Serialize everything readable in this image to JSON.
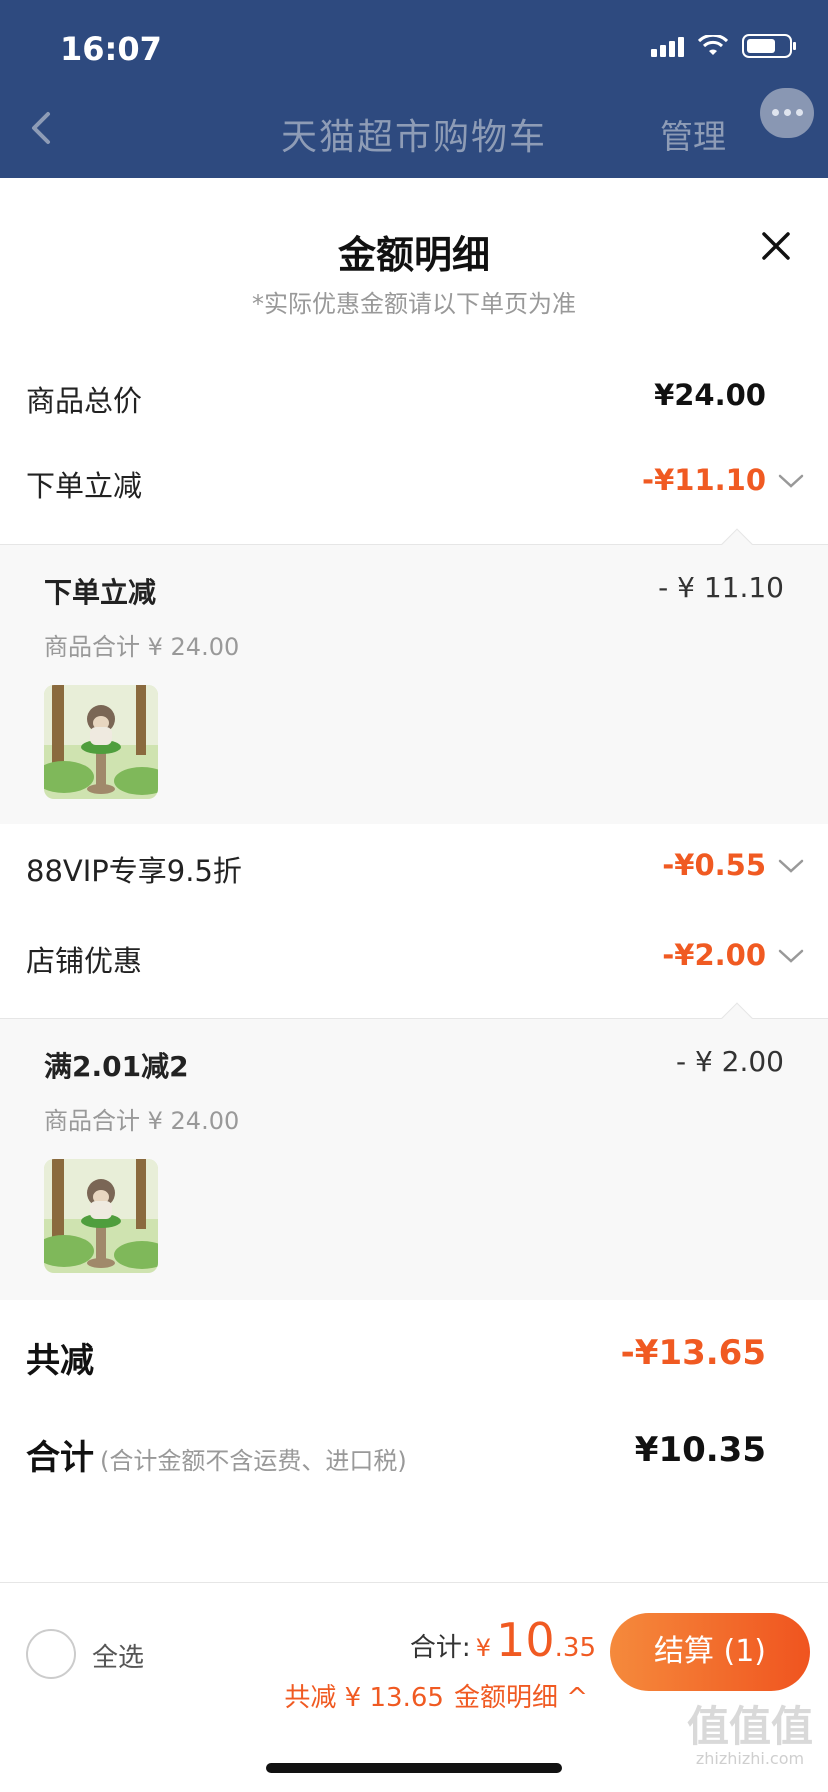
{
  "status_bar": {
    "time": "16:07"
  },
  "nav": {
    "title": "天猫超市购物车",
    "manage": "管理"
  },
  "sheet": {
    "title": "金额明细",
    "subtitle": "*实际优惠金额请以下单页为准",
    "rows": {
      "goods_total": {
        "label": "商品总价",
        "value": "¥24.00"
      },
      "instant_discount": {
        "label": "下单立减",
        "value": "-¥11.10"
      },
      "vip_discount": {
        "label": "88VIP专享9.5折",
        "value": "-¥0.55"
      },
      "shop_discount": {
        "label": "店铺优惠",
        "value": "-¥2.00"
      }
    },
    "details": {
      "instant": {
        "title": "下单立减",
        "amount": "- ¥ 11.10",
        "sub": "商品合计 ¥ 24.00"
      },
      "shop": {
        "title": "满2.01减2",
        "amount": "- ¥ 2.00",
        "sub": "商品合计 ¥ 24.00"
      }
    },
    "total_reduction": {
      "label": "共减",
      "value": "-¥13.65"
    },
    "grand_total": {
      "label": "合计",
      "note": "(合计金额不含运费、进口税)",
      "value": "¥10.35"
    }
  },
  "bottom_bar": {
    "select_all": "全选",
    "total_label": "合计:",
    "currency": "¥",
    "total_int": "10",
    "total_dec": ".35",
    "reduction_text": "共减 ¥ 13.65",
    "detail_link": "金额明细 ^",
    "checkout": "结算 (1)"
  },
  "watermark": {
    "main": "值值值",
    "sub": "zhizhizhi.com"
  },
  "colors": {
    "header": "#2e4a7f",
    "accent_orange": "#f05a22",
    "detail_bg": "#f8f8f8"
  },
  "icons": [
    "back-chevron-icon",
    "more-dots-icon",
    "close-icon",
    "chevron-down-icon",
    "product-thumbnail"
  ]
}
